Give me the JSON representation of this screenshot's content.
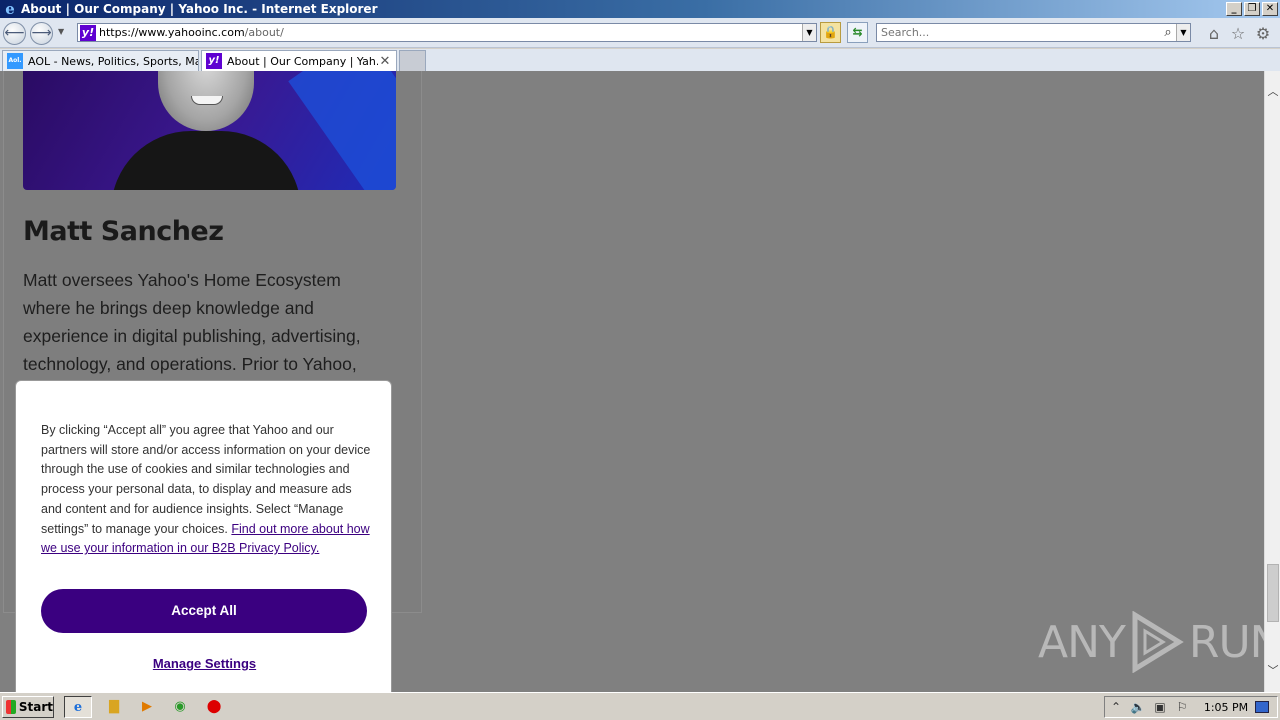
{
  "window": {
    "title": "About | Our Company | Yahoo Inc. - Internet Explorer",
    "min": "_",
    "restore": "❐",
    "close": "✕"
  },
  "address_bar": {
    "url_host": "https://www.yahooinc.com",
    "url_path": "/about/",
    "favicon_text": "y!"
  },
  "search": {
    "placeholder": "Search..."
  },
  "tabs": [
    {
      "label": "AOL - News, Politics, Sports, Ma...",
      "favicon": "Aol."
    },
    {
      "label": "About | Our Company | Yah...",
      "favicon": "y!"
    }
  ],
  "page": {
    "person_name": "Matt Sanchez",
    "bio": "Matt oversees Yahoo's Home Ecosystem where he brings deep knowledge and experience in digital publishing, advertising, technology, and operations. Prior to Yahoo,"
  },
  "cookie_banner": {
    "text": "By clicking “Accept all” you agree that Yahoo and our partners will store and/or access information on your device through the use of cookies and similar technologies and process your personal data, to display and measure ads and content and for audience insights. Select “Manage settings” to manage your choices. ",
    "link": "Find out more about how we use your information in our B2B Privacy Policy.",
    "accept_label": "Accept All",
    "manage_label": "Manage Settings"
  },
  "watermark": {
    "left": "ANY",
    "right": "RUN"
  },
  "taskbar": {
    "start_label": "Start",
    "clock": "1:05 PM"
  },
  "colors": {
    "yahoo_purple": "#3a0080",
    "page_overlay": "#808080"
  }
}
